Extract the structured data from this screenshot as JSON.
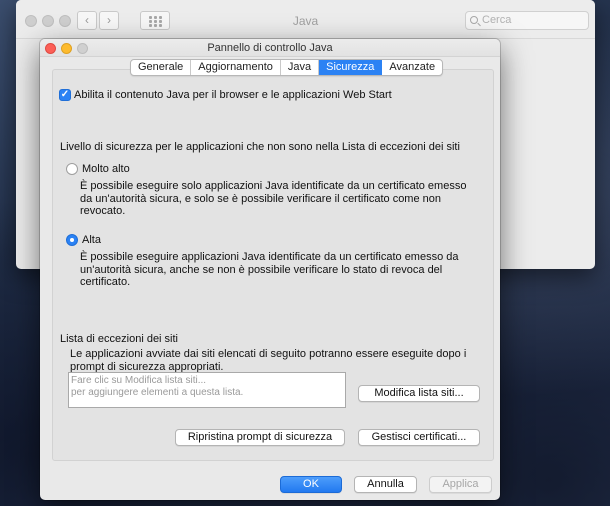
{
  "background_window": {
    "title": "Java",
    "search_placeholder": "Cerca",
    "back_arrow": "‹",
    "forward_arrow": "›"
  },
  "dialog": {
    "title": "Pannello di controllo Java",
    "tabs": [
      {
        "label": "Generale",
        "active": false
      },
      {
        "label": "Aggiornamento",
        "active": false
      },
      {
        "label": "Java",
        "active": false
      },
      {
        "label": "Sicurezza",
        "active": true
      },
      {
        "label": "Avanzate",
        "active": false
      }
    ],
    "enable_checkbox": {
      "label": "Abilita il contenuto Java per il browser e le applicazioni Web Start",
      "checked": true
    },
    "security_level": {
      "heading": "Livello di sicurezza per le applicazioni che non sono nella Lista di eccezioni dei siti",
      "options": [
        {
          "label": "Molto alto",
          "selected": false,
          "description": "È possibile eseguire solo applicazioni Java identificate da un certificato emesso da un'autorità sicura, e solo se è possibile verificare il certificato come non revocato."
        },
        {
          "label": "Alta",
          "selected": true,
          "description": "È possibile eseguire applicazioni Java identificate da un certificato emesso da un'autorità sicura, anche se non è possibile verificare lo stato di revoca del certificato."
        }
      ]
    },
    "exception_list": {
      "heading": "Lista di eccezioni dei siti",
      "description": "Le applicazioni avviate dai siti elencati di seguito potranno essere eseguite dopo i prompt di sicurezza appropriati.",
      "placeholder_line1": "Fare clic su Modifica lista siti...",
      "placeholder_line2": "per aggiungere elementi a questa lista.",
      "edit_button": "Modifica lista siti..."
    },
    "restore_prompts_button": "Ripristina prompt di sicurezza",
    "manage_certificates_button": "Gestisci certificati...",
    "ok_button": "OK",
    "cancel_button": "Annulla",
    "apply_button": "Applica",
    "accent_color": "#2b82f4"
  }
}
